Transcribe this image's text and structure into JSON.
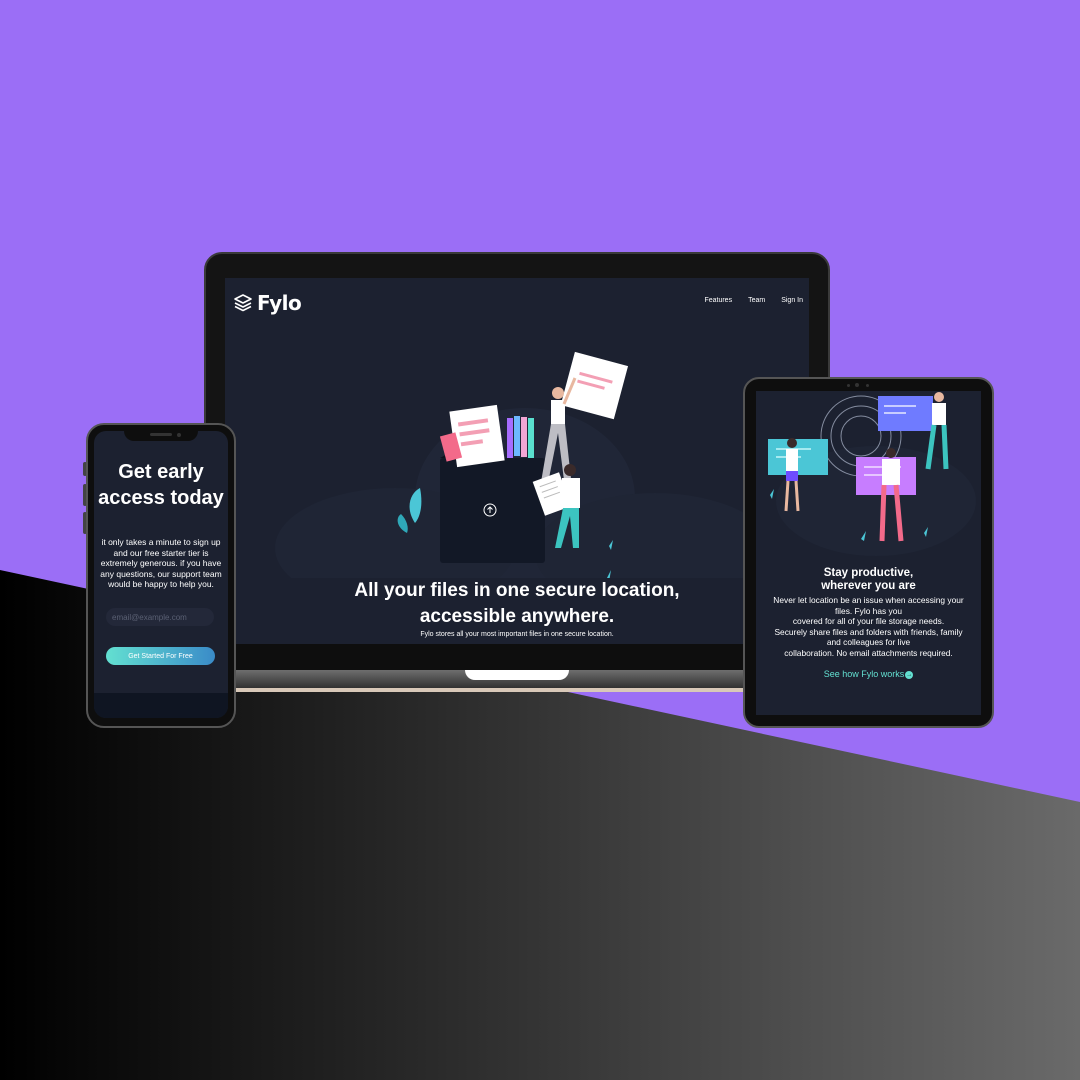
{
  "colors": {
    "background_purple": "#9b6ef6",
    "screen_bg": "#1c2130",
    "accent_cyan": "#63e0d1",
    "accent_blue": "#3a8bc8"
  },
  "laptop": {
    "logo_text": "Fylo",
    "logo_icon": "stacked-layers-icon",
    "nav": [
      "Features",
      "Team",
      "Sign In"
    ],
    "hero_title_line1": "All your files in one secure location,",
    "hero_title_line2": "accessible anywhere.",
    "hero_text": "Fylo stores all your most important files in one secure location."
  },
  "phone": {
    "title": "Get early access today",
    "body": "it only takes a minute to sign up and our free starter tier is extremely generous. if you have any questions, our support team would be happy to help you.",
    "email_placeholder": "email@example.com",
    "cta_label": "Get Started For Free"
  },
  "tablet": {
    "title_line1": "Stay productive,",
    "title_line2": "wherever you are",
    "body_line1": "Never let location be an issue when accessing your",
    "body_line2": "files. Fylo has you",
    "body_line3": "covered for all of your file storage needs.",
    "body_line4": "Securely share files and folders with friends, family",
    "body_line5": "and colleagues for live",
    "body_line6": "collaboration. No email attachments required.",
    "link_label": "See how Fylo works",
    "link_icon": "arrow-right-circle-icon"
  }
}
